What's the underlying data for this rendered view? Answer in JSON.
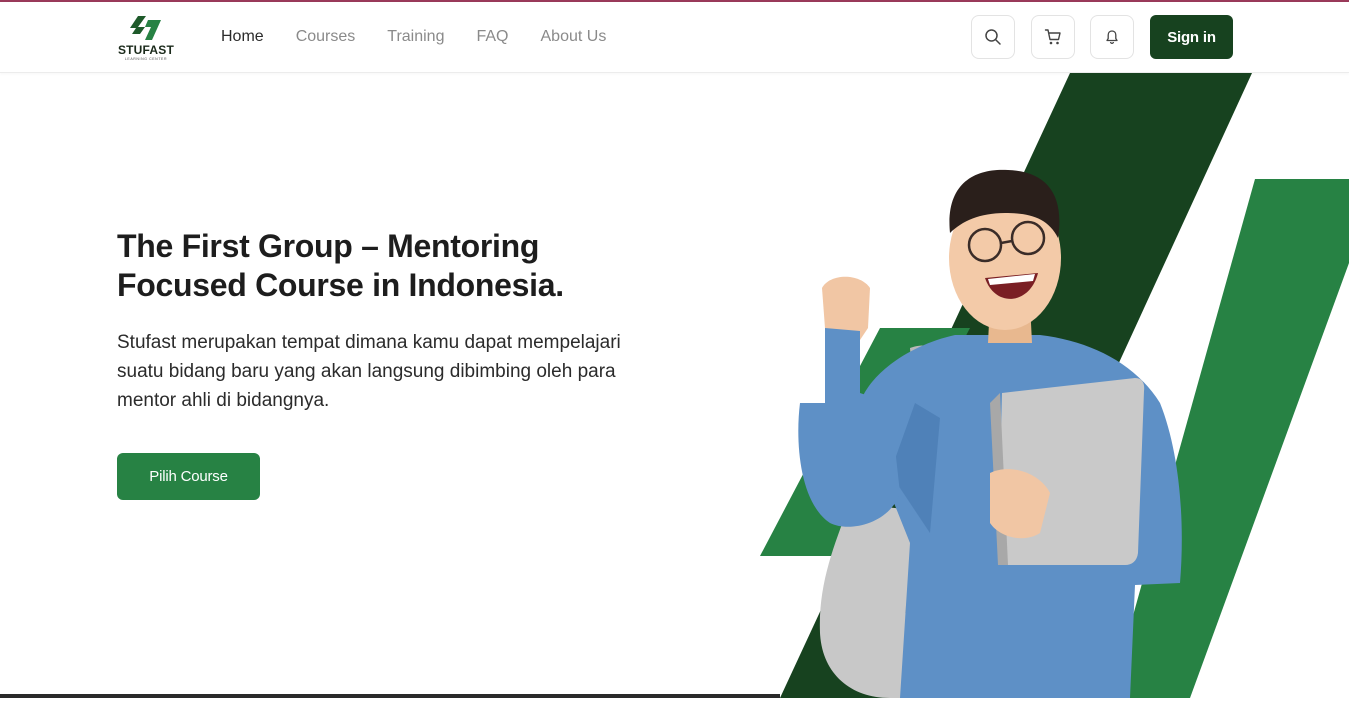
{
  "brand": {
    "name": "STUFAST",
    "tagline": "LEARNING CENTER"
  },
  "nav": {
    "links": [
      {
        "label": "Home",
        "active": true
      },
      {
        "label": "Courses",
        "active": false
      },
      {
        "label": "Training",
        "active": false
      },
      {
        "label": "FAQ",
        "active": false
      },
      {
        "label": "About Us",
        "active": false
      }
    ],
    "icons": [
      "search-icon",
      "cart-icon",
      "bell-icon"
    ],
    "signin_label": "Sign in"
  },
  "hero": {
    "title_line1": "The First Group – Mentoring",
    "title_line2": "Focused Course in Indonesia.",
    "desc_line1": "Stufast merupakan tempat dimana kamu dapat mempelajari",
    "desc_line2": "suatu bidang baru yang akan langsung dibimbing oleh para",
    "desc_line3": "mentor ahli di bidangnya.",
    "cta_label": "Pilih Course"
  },
  "colors": {
    "dark_green": "#17421f",
    "green": "#278244",
    "accent_line": "#9a3a5a"
  }
}
